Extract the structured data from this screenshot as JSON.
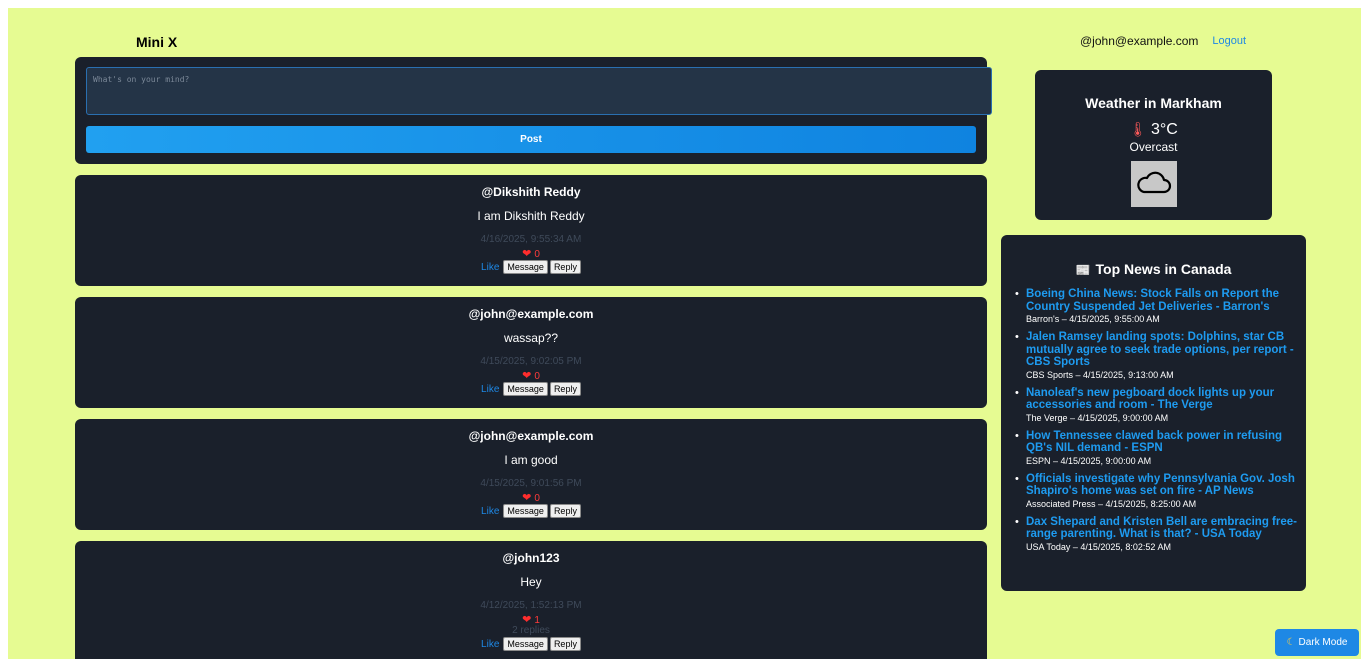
{
  "header": {
    "brand": "Mini X",
    "user_email": "@john@example.com",
    "logout_label": "Logout"
  },
  "composer": {
    "placeholder": "What's on your mind?",
    "post_label": "Post"
  },
  "posts": [
    {
      "author": "@Dikshith Reddy",
      "body": "I am Dikshith Reddy",
      "time": "4/16/2025, 9:55:34 AM",
      "likes": "0",
      "replies": "",
      "like_label": "Like",
      "message_label": "Message",
      "reply_label": "Reply"
    },
    {
      "author": "@john@example.com",
      "body": "wassap??",
      "time": "4/15/2025, 9:02:05 PM",
      "likes": "0",
      "replies": "",
      "like_label": "Like",
      "message_label": "Message",
      "reply_label": "Reply"
    },
    {
      "author": "@john@example.com",
      "body": "I am good",
      "time": "4/15/2025, 9:01:56 PM",
      "likes": "0",
      "replies": "",
      "like_label": "Like",
      "message_label": "Message",
      "reply_label": "Reply"
    },
    {
      "author": "@john123",
      "body": "Hey",
      "time": "4/12/2025, 1:52:13 PM",
      "likes": "1",
      "replies": "2 replies",
      "like_label": "Like",
      "message_label": "Message",
      "reply_label": "Reply"
    }
  ],
  "weather": {
    "title": "Weather in Markham",
    "temperature": "3°C",
    "condition": "Overcast",
    "icon": "cloud-icon"
  },
  "news": {
    "title": "Top News in Canada",
    "items": [
      {
        "headline": "Boeing China News: Stock Falls on Report the Country Suspended Jet Deliveries - Barron's",
        "meta": "Barron's – 4/15/2025, 9:55:00 AM"
      },
      {
        "headline": "Jalen Ramsey landing spots: Dolphins, star CB mutually agree to seek trade options, per report - CBS Sports",
        "meta": "CBS Sports – 4/15/2025, 9:13:00 AM"
      },
      {
        "headline": "Nanoleaf's new pegboard dock lights up your accessories and room - The Verge",
        "meta": "The Verge – 4/15/2025, 9:00:00 AM"
      },
      {
        "headline": "How Tennessee clawed back power in refusing QB's NIL demand - ESPN",
        "meta": "ESPN – 4/15/2025, 9:00:00 AM"
      },
      {
        "headline": "Officials investigate why Pennsylvania Gov. Josh Shapiro's home was set on fire - AP News",
        "meta": "Associated Press – 4/15/2025, 8:25:00 AM"
      },
      {
        "headline": "Dax Shepard and Kristen Bell are embracing free-range parenting. What is that? - USA Today",
        "meta": "USA Today – 4/15/2025, 8:02:52 AM"
      }
    ]
  },
  "dark_mode_label": "Dark Mode",
  "colors": {
    "page_bg": "#e6fb92",
    "card_bg": "#1a202b",
    "accent": "#1e88e5",
    "heart": "#ff2d2d"
  }
}
